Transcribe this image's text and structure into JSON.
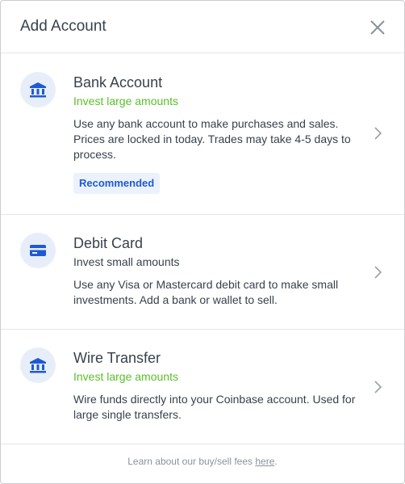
{
  "dialog": {
    "title": "Add Account",
    "close_icon": "close-icon"
  },
  "options": [
    {
      "title": "Bank Account",
      "subtitle": "Invest large amounts",
      "subtitle_color": "#5abf2a",
      "description": "Use any bank account to make purchases and sales. Prices are locked in today. Trades may take 4-5 days to process.",
      "badge": "Recommended",
      "icon": "bank-icon"
    },
    {
      "title": "Debit Card",
      "subtitle": "Invest small amounts",
      "subtitle_color": "#39414c",
      "description": "Use any Visa or Mastercard debit card to make small investments. Add a bank or wallet to sell.",
      "icon": "credit-card-icon"
    },
    {
      "title": "Wire Transfer",
      "subtitle": "Invest large amounts",
      "subtitle_color": "#5abf2a",
      "description": "Wire funds directly into your Coinbase account. Used for large single transfers.",
      "icon": "bank-icon"
    }
  ],
  "footer": {
    "text_before": "Learn about our buy/sell fees ",
    "link": "here",
    "text_after": "."
  },
  "colors": {
    "accent": "#1d5bd4",
    "green": "#5abf2a",
    "icon_bg": "#e8eef9"
  }
}
